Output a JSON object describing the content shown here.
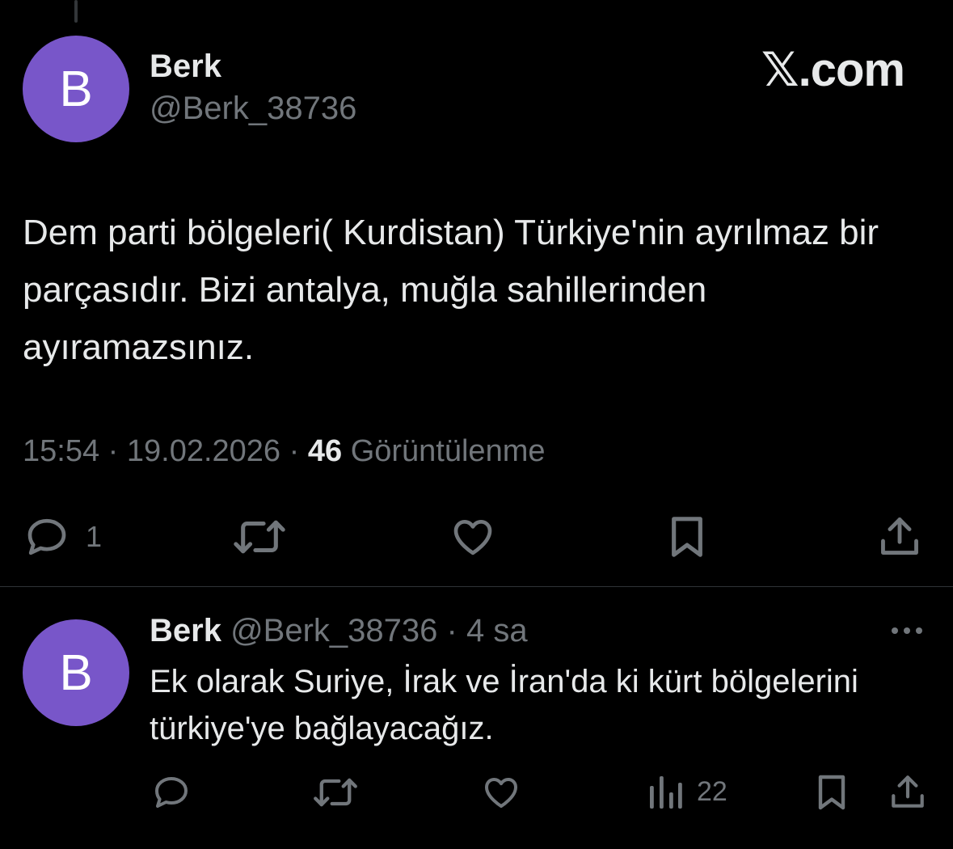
{
  "main_tweet": {
    "avatar_letter": "B",
    "display_name": "Berk",
    "handle": "@Berk_38736",
    "brand": "𝕏.com",
    "text": "Dem parti bölgeleri( Kurdistan) Türkiye'nin ayrılmaz bir parçasıdır. Bizi antalya, muğla sahillerinden ayıramazsınız.",
    "time": "15:54",
    "date": "19.02.2026",
    "views_count": "46",
    "views_label": "Görüntülenme",
    "reply_count": "1"
  },
  "reply_tweet": {
    "avatar_letter": "B",
    "display_name": "Berk",
    "handle": "@Berk_38736",
    "separator": "·",
    "time_ago": "4 sa",
    "text": "Ek olarak Suriye, İrak ve İran'da ki kürt bölgelerini türkiye'ye bağlayacağız.",
    "views_count": "22"
  },
  "colors": {
    "background": "#000000",
    "primary_text": "#e7e9ea",
    "secondary_text": "#71767b",
    "avatar": "#7856c9",
    "divider": "#2f3336"
  },
  "icons": [
    "reply-icon",
    "retweet-icon",
    "like-icon",
    "views-icon",
    "bookmark-icon",
    "share-icon",
    "more-icon"
  ]
}
